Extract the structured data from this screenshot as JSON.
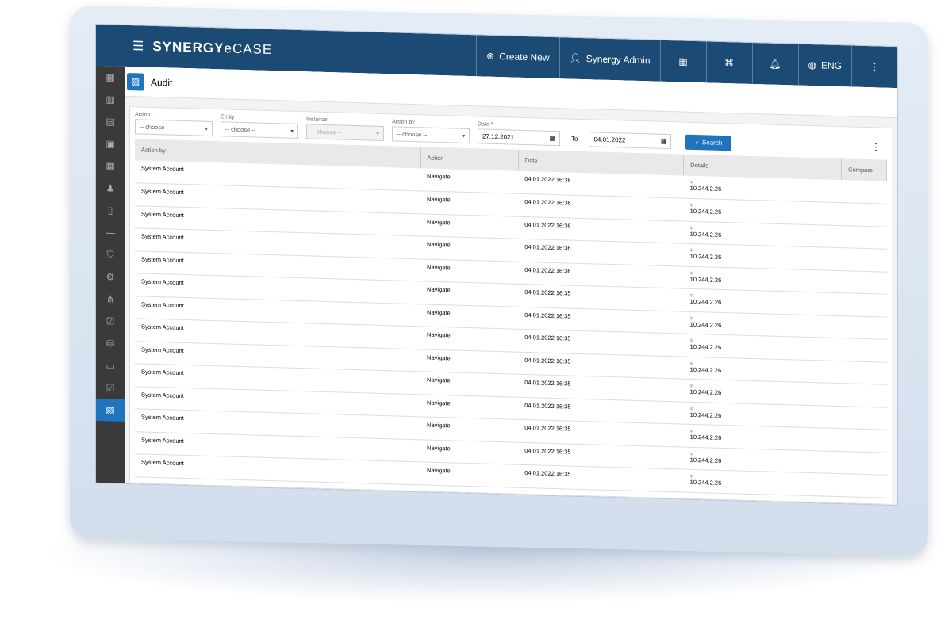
{
  "topbar": {
    "brand_bold": "SYNERGY",
    "brand_light": "eCASE",
    "create_new": "Create New",
    "user": "Synergy Admin",
    "language": "ENG"
  },
  "page": {
    "title": "Audit"
  },
  "filters": {
    "action_label": "Action",
    "entity_label": "Entity",
    "instance_label": "Instance",
    "action_by_label": "Action by",
    "date_label": "Date",
    "placeholder": "-- choose --",
    "date_from": "27.12.2021",
    "to_label": "To",
    "date_to": "04.01.2022",
    "search_label": "Search"
  },
  "table": {
    "columns": [
      "Action by",
      "Action",
      "Date",
      "Details",
      "Compare"
    ],
    "rows": [
      {
        "by": "System Account",
        "action": "Navigate",
        "date": "04.01.2022 16:38",
        "ip_label": "ip",
        "ip": "10.244.2.26"
      },
      {
        "by": "System Account",
        "action": "Navigate",
        "date": "04.01.2022 16:36",
        "ip_label": "ip",
        "ip": "10.244.2.26"
      },
      {
        "by": "System Account",
        "action": "Navigate",
        "date": "04.01.2022 16:36",
        "ip_label": "ip",
        "ip": "10.244.2.26"
      },
      {
        "by": "System Account",
        "action": "Navigate",
        "date": "04.01.2022 16:36",
        "ip_label": "ip",
        "ip": "10.244.2.26"
      },
      {
        "by": "System Account",
        "action": "Navigate",
        "date": "04.01.2022 16:36",
        "ip_label": "ip",
        "ip": "10.244.2.26"
      },
      {
        "by": "System Account",
        "action": "Navigate",
        "date": "04.01.2022 16:35",
        "ip_label": "ip",
        "ip": "10.244.2.26"
      },
      {
        "by": "System Account",
        "action": "Navigate",
        "date": "04.01.2022 16:35",
        "ip_label": "ip",
        "ip": "10.244.2.26"
      },
      {
        "by": "System Account",
        "action": "Navigate",
        "date": "04.01.2022 16:35",
        "ip_label": "ip",
        "ip": "10.244.2.26"
      },
      {
        "by": "System Account",
        "action": "Navigate",
        "date": "04.01.2022 16:35",
        "ip_label": "ip",
        "ip": "10.244.2.26"
      },
      {
        "by": "System Account",
        "action": "Navigate",
        "date": "04.01.2022 16:35",
        "ip_label": "ip",
        "ip": "10.244.2.26"
      },
      {
        "by": "System Account",
        "action": "Navigate",
        "date": "04.01.2022 16:35",
        "ip_label": "ip",
        "ip": "10.244.2.26"
      },
      {
        "by": "System Account",
        "action": "Navigate",
        "date": "04.01.2022 16:35",
        "ip_label": "ip",
        "ip": "10.244.2.26"
      },
      {
        "by": "System Account",
        "action": "Navigate",
        "date": "04.01.2022 16:35",
        "ip_label": "ip",
        "ip": "10.244.2.26"
      },
      {
        "by": "System Account",
        "action": "Navigate",
        "date": "04.01.2022 16:35",
        "ip_label": "ip",
        "ip": "10.244.2.26"
      }
    ]
  },
  "colors": {
    "topbar": "#1b4a74",
    "accent": "#1f74bd",
    "sidebar": "#3a3a3a"
  }
}
